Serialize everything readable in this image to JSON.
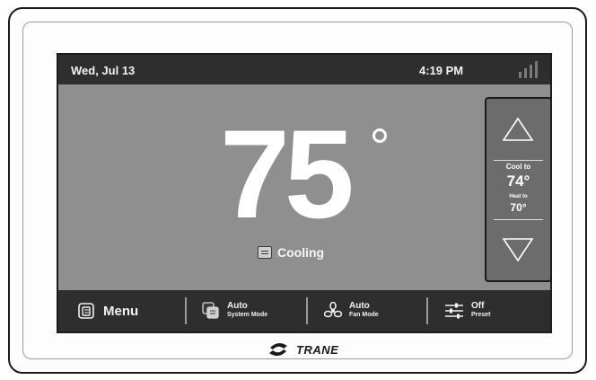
{
  "status_bar": {
    "date": "Wed, Jul 13",
    "time": "4:19 PM",
    "signal_icon": "signal-bars-icon"
  },
  "main": {
    "current_temperature": "75",
    "status": "Cooling"
  },
  "setpoints": {
    "cool_label": "Cool to",
    "cool_value": "74°",
    "heat_label": "Heat to",
    "heat_value": "70°"
  },
  "bottom_bar": {
    "menu_label": "Menu",
    "system_mode_value": "Auto",
    "system_mode_label": "System Mode",
    "fan_mode_value": "Auto",
    "fan_mode_label": "Fan Mode",
    "preset_value": "Off",
    "preset_label": "Preset"
  },
  "brand": {
    "name": "TRANE"
  },
  "colors": {
    "screen_bg": "#8f8f8f",
    "bar_bg": "#2e2e2e",
    "panel_bg": "#6c6c6c",
    "text": "#ffffff"
  }
}
